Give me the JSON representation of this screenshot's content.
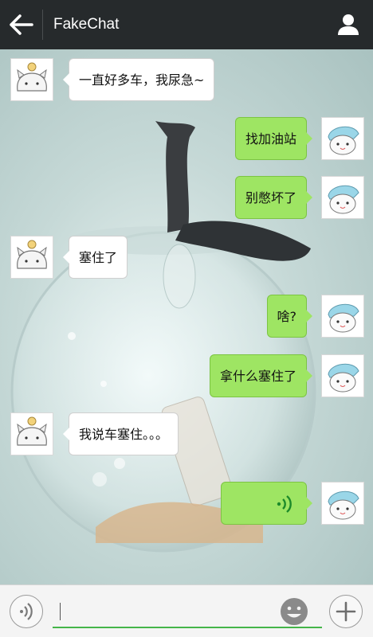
{
  "header": {
    "title": "FakeChat",
    "back_icon": "back-arrow-icon",
    "profile_icon": "person-icon"
  },
  "messages": [
    {
      "side": "left",
      "sender": "cat",
      "text": "一直好多车，我尿急~"
    },
    {
      "side": "right",
      "sender": "dragon",
      "text": "找加油站"
    },
    {
      "side": "right",
      "sender": "dragon",
      "text": "别憋坏了"
    },
    {
      "side": "left",
      "sender": "cat",
      "text": "塞住了"
    },
    {
      "side": "right",
      "sender": "dragon",
      "text": "啥?"
    },
    {
      "side": "right",
      "sender": "dragon",
      "text": "拿什么塞住了"
    },
    {
      "side": "left",
      "sender": "cat",
      "text": "我说车塞住。。。"
    },
    {
      "side": "right",
      "sender": "dragon",
      "type": "voice",
      "text": ""
    }
  ],
  "input": {
    "value": "",
    "voice_icon": "voice-mode-icon",
    "emoji_icon": "emoji-icon",
    "add_icon": "plus-icon"
  },
  "colors": {
    "header_bg": "#262a2c",
    "bubble_self": "#9ee563",
    "bubble_other": "#ffffff",
    "input_underline": "#44b549"
  }
}
